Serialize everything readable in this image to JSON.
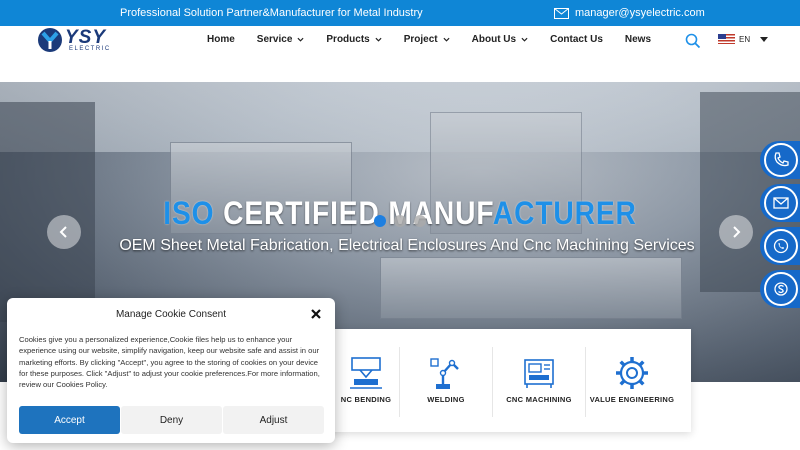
{
  "topbar": {
    "tagline": "Professional Solution Partner&Manufacturer for Metal Industry",
    "email": "manager@ysyelectric.com"
  },
  "logo": {
    "brand": "YSY",
    "sub": "ELECTRIC"
  },
  "nav": {
    "items": [
      {
        "label": "Home",
        "dropdown": false
      },
      {
        "label": "Service",
        "dropdown": true
      },
      {
        "label": "Products",
        "dropdown": true
      },
      {
        "label": "Project",
        "dropdown": true
      },
      {
        "label": "About Us",
        "dropdown": true
      },
      {
        "label": "Contact Us",
        "dropdown": false
      },
      {
        "label": "News",
        "dropdown": false
      }
    ],
    "language": "EN"
  },
  "hero": {
    "title_part1": "ISO ",
    "title_part2": "C",
    "title_part3": "ERTIFIED MANUF",
    "title_part4": "ACTURER",
    "subtitle": "OEM Sheet Metal Fabrication, Electrical Enclosures And Cnc Machining Services",
    "slides": 3,
    "active_slide": 1
  },
  "float_icons": [
    "phone-icon",
    "mail-icon",
    "whatsapp-icon",
    "skype-icon"
  ],
  "services": [
    {
      "label": "NC BENDING",
      "icon": "bending-icon"
    },
    {
      "label": "WELDING",
      "icon": "welding-robot-icon"
    },
    {
      "label": "CNC MACHINING",
      "icon": "cnc-machine-icon"
    },
    {
      "label": "VALUE ENGINEERING",
      "icon": "gear-icon"
    }
  ],
  "cookie": {
    "title": "Manage Cookie Consent",
    "body": "Cookies give you a personalized experience,Cookie files help us to enhance your experience using our website, simplify navigation, keep our website safe and assist in our marketing efforts. By clicking \"Accept\", you agree to the storing of cookies on your device for these purposes. Click \"Adjust\" to adjust your cookie preferences.For more information, review our Cookies Policy.",
    "accept": "Accept",
    "deny": "Deny",
    "adjust": "Adjust"
  },
  "colors": {
    "brand_blue": "#0f86d6",
    "accent_blue": "#1e90e8",
    "float_blue": "#1669c9",
    "accept_blue": "#1e73be"
  }
}
